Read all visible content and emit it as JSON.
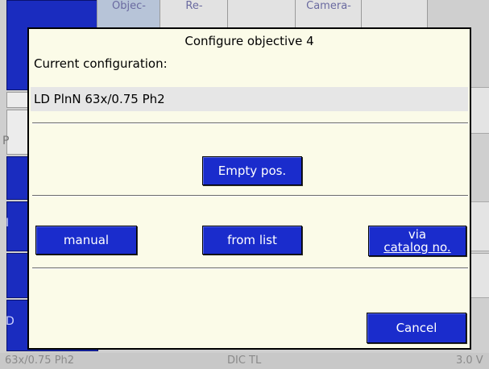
{
  "window_title": "Configure objective 4",
  "current_label": "Current configuration:",
  "current_value": "LD PlnN 63x/0.75 Ph2",
  "buttons": {
    "empty": "Empty pos.",
    "manual": "manual",
    "from_list": "from list",
    "via_catalog_line1": "via",
    "via_catalog_line2": "catalog no.",
    "cancel": "Cancel"
  },
  "background_tabs": [
    "Objec-",
    "Re-",
    "",
    "Camera-",
    ""
  ],
  "background_left_glyphs": [
    "P",
    "I",
    "D"
  ],
  "status_bar": {
    "objective": "63x/0.75 Ph2",
    "mode": "DIC TL",
    "value": "3.0 V"
  },
  "colors": {
    "dialog_bg": "#fbfbe8",
    "button_blue": "#1a2ccc",
    "button_text": "#ffffff",
    "config_bg": "#e6e6e6"
  }
}
